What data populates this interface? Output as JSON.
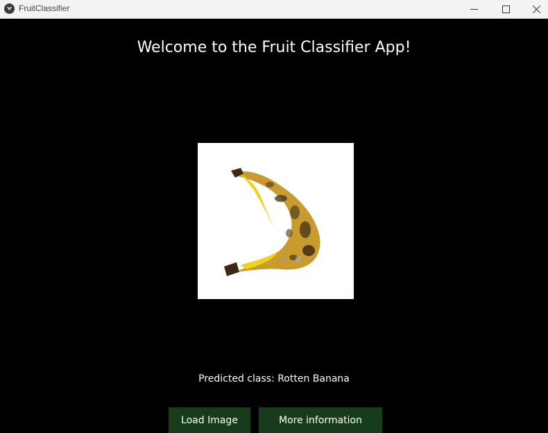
{
  "window": {
    "title": "FruitClassifier",
    "icons": {
      "app": "kivy-app-icon",
      "minimize": "minimize-icon",
      "maximize": "maximize-icon",
      "close": "close-icon"
    }
  },
  "main": {
    "heading": "Welcome to the Fruit Classifier App!",
    "image": {
      "subject": "rotten-banana-image"
    },
    "prediction": "Predicted class: Rotten Banana",
    "buttons": {
      "load_image": "Load Image",
      "more_info": "More information"
    }
  },
  "colors": {
    "background": "#000000",
    "button": "#163c1c",
    "titlebar": "#f3f3f3",
    "text": "#ffffff"
  }
}
